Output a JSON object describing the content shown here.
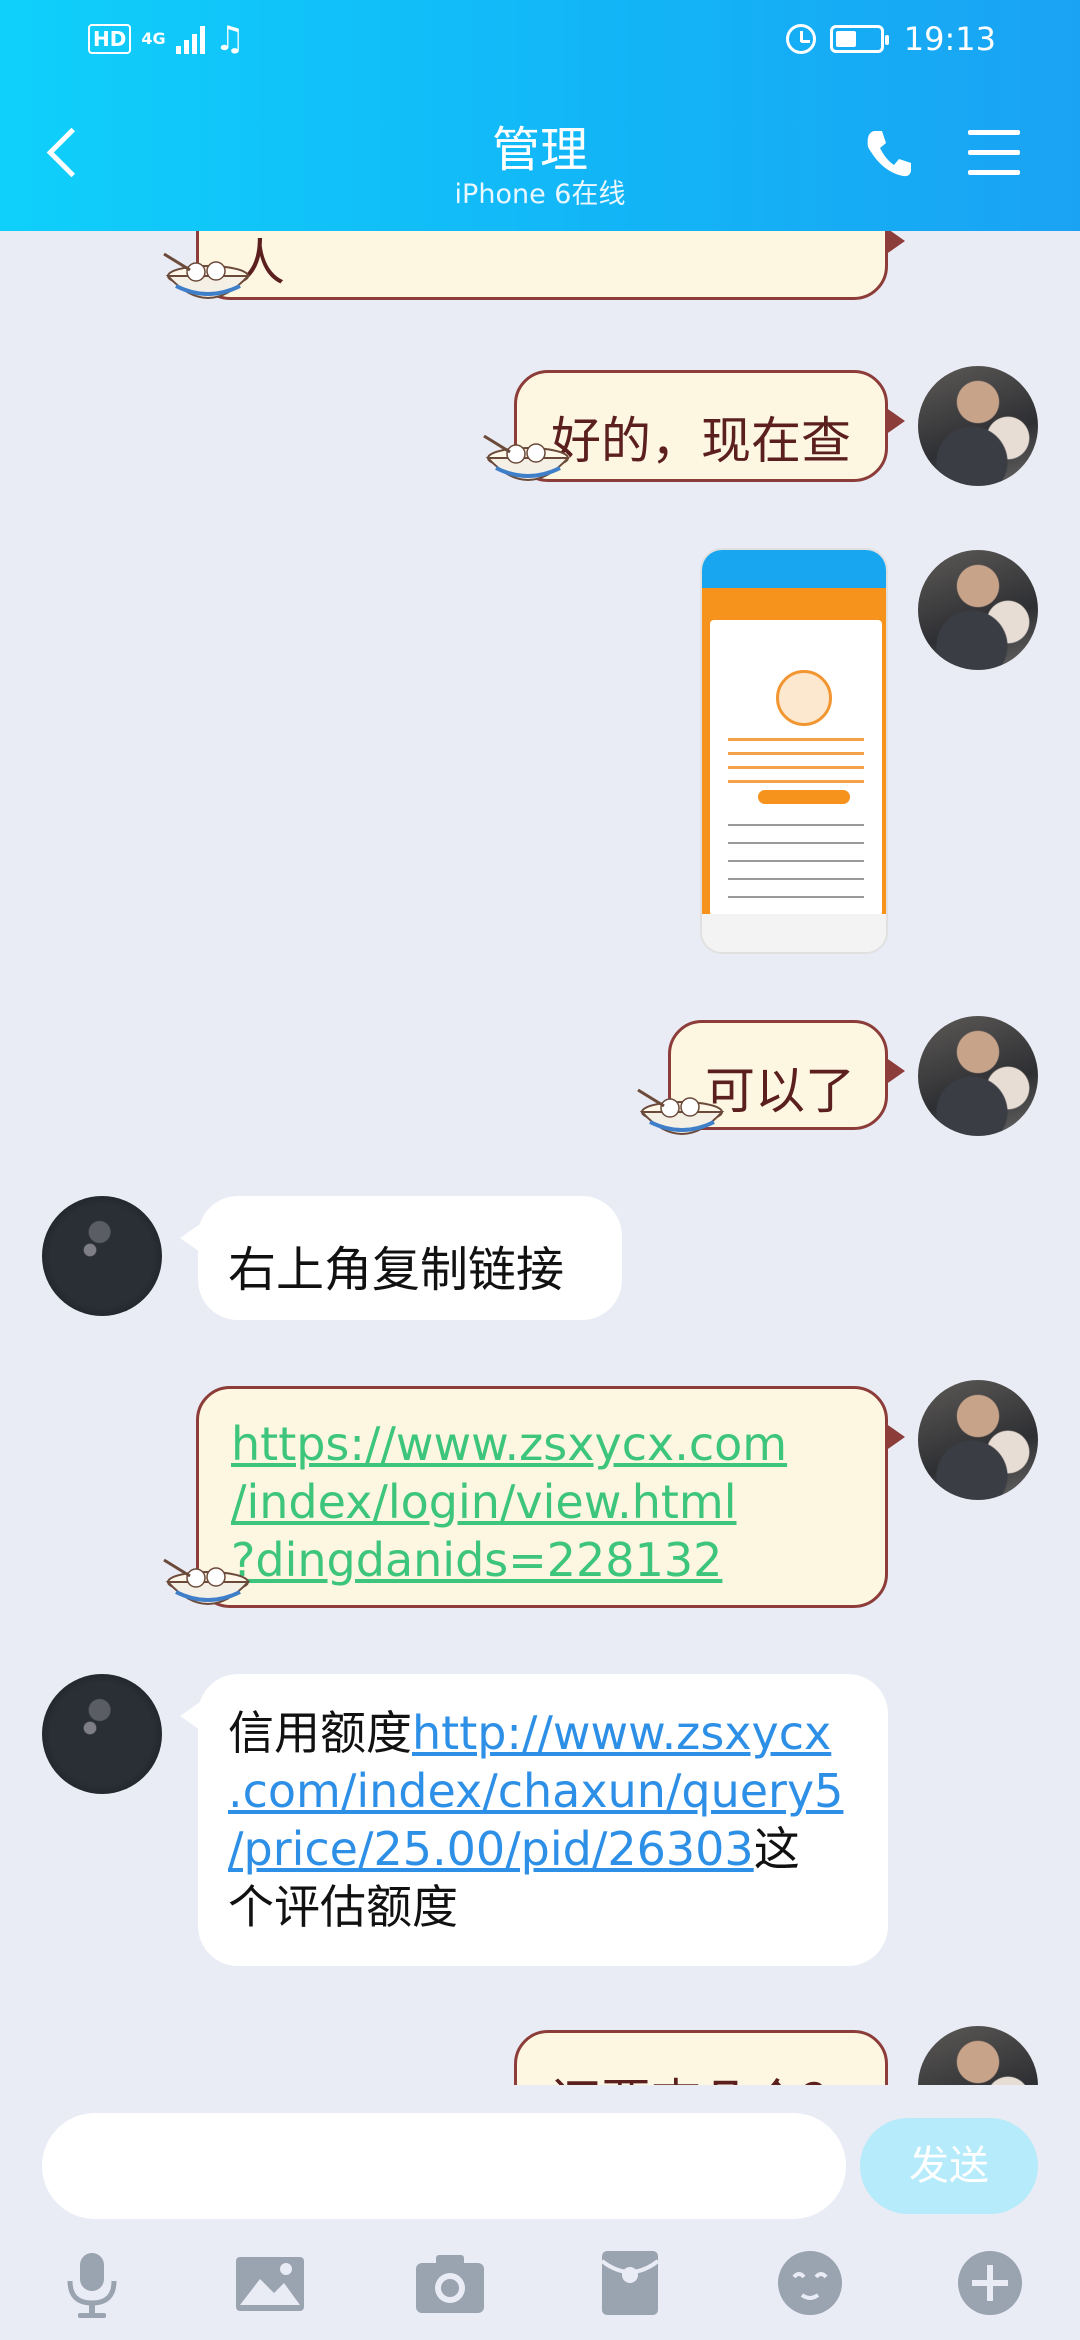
{
  "status_bar": {
    "hd": "HD",
    "network": "4G",
    "time": "19:13"
  },
  "header": {
    "title": "管理",
    "subtitle": "iPhone 6在线"
  },
  "messages": {
    "m0_partial": "人",
    "m1": "好的，现在查",
    "m3": "可以了",
    "m4": "右上角复制链接",
    "m5_link_line1": "https://www.zsxycx.com",
    "m5_link_line2": "/index/login/view.html",
    "m5_link_line3": "?dingdanids=228132",
    "m6_prefix": "信用额度",
    "m6_link_line1": "http://www.zsxycx",
    "m6_link_line2": ".com/index/chaxun/query5",
    "m6_link_line3": "/price/25.00/pid/26303",
    "m6_suffix_line3": "这",
    "m6_suffix_line4": "个评估额度",
    "m7_partial": "还要查几个？"
  },
  "input": {
    "placeholder": "",
    "send_label": "发送"
  },
  "toolbar_icons": [
    "mic-icon",
    "image-icon",
    "camera-icon",
    "red-packet-icon",
    "emoji-icon",
    "plus-icon"
  ],
  "colors": {
    "header_start": "#0fd0fb",
    "header_end": "#1aa3f3",
    "my_bubble": "#fdf6e0",
    "my_bubble_border": "#8c3d3a",
    "link_green": "#3cc57b",
    "link_blue": "#2d8fe6",
    "send_button": "#b6ebfb"
  }
}
